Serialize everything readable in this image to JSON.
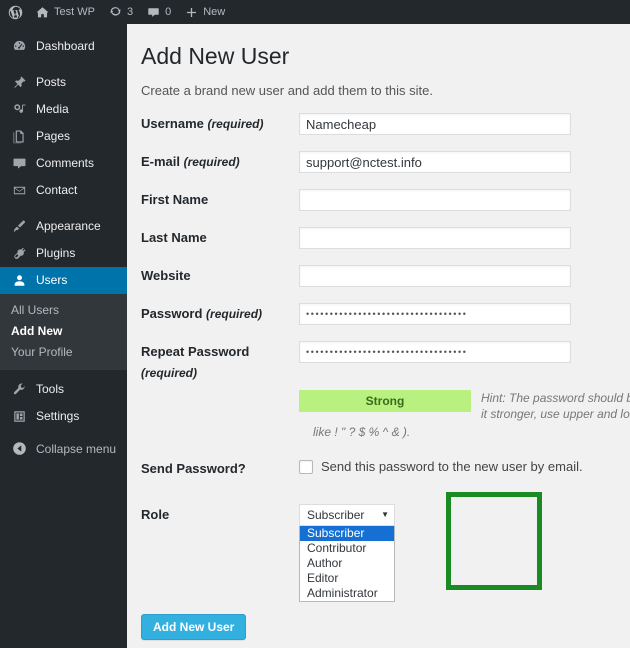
{
  "adminbar": {
    "items": [
      {
        "icon": "wordpress-logo-icon",
        "label": ""
      },
      {
        "icon": "home-icon",
        "label": "Test WP"
      },
      {
        "icon": "updates-icon",
        "label": "3"
      },
      {
        "icon": "comments-icon",
        "label": "0"
      },
      {
        "icon": "plus-icon",
        "label": "New"
      }
    ]
  },
  "sidebar": {
    "items": [
      {
        "label": "Dashboard",
        "icon": "dashboard-icon",
        "current": false
      },
      {
        "label": "Posts",
        "icon": "pin-icon",
        "current": false
      },
      {
        "label": "Media",
        "icon": "media-icon",
        "current": false
      },
      {
        "label": "Pages",
        "icon": "pages-icon",
        "current": false
      },
      {
        "label": "Comments",
        "icon": "comment-bubble-icon",
        "current": false
      },
      {
        "label": "Contact",
        "icon": "envelope-icon",
        "current": false
      },
      {
        "label": "Appearance",
        "icon": "paintbrush-icon",
        "current": false
      },
      {
        "label": "Plugins",
        "icon": "plug-icon",
        "current": false
      },
      {
        "label": "Users",
        "icon": "user-icon",
        "current": true
      },
      {
        "label": "Tools",
        "icon": "wrench-icon",
        "current": false
      },
      {
        "label": "Settings",
        "icon": "settings-icon",
        "current": false
      }
    ],
    "submenu": [
      {
        "label": "All Users",
        "current": false
      },
      {
        "label": "Add New",
        "current": true
      },
      {
        "label": "Your Profile",
        "current": false
      }
    ],
    "collapse": {
      "label": "Collapse menu",
      "icon": "collapse-arrow-icon"
    }
  },
  "page": {
    "title": "Add New User",
    "description": "Create a brand new user and add them to this site."
  },
  "form": {
    "username": {
      "label": "Username",
      "required_text": "(required)",
      "value": "Namecheap"
    },
    "email": {
      "label": "E-mail",
      "required_text": "(required)",
      "value": "support@nctest.info"
    },
    "first_name": {
      "label": "First Name",
      "value": ""
    },
    "last_name": {
      "label": "Last Name",
      "value": ""
    },
    "website": {
      "label": "Website",
      "value": ""
    },
    "password": {
      "label": "Password",
      "required_text": "(required)",
      "masked": "••••••••••••••••••••••••••••••••••"
    },
    "repeat_password": {
      "label": "Repeat Password",
      "required_text": "(required)",
      "masked": "••••••••••••••••••••••••••••••••••"
    },
    "strength": {
      "label": "Strong",
      "color": "#b8f17f"
    },
    "hint_line1": "Hint: The password should be a",
    "hint_line2": "it stronger, use upper and lowe",
    "hint_line3": "like ! \" ? $ % ^ & ).",
    "send_password": {
      "label": "Send Password?",
      "checkbox_label": "Send this password to the new user by email.",
      "checked": false
    },
    "role": {
      "label": "Role",
      "selected": "Subscriber",
      "options": [
        "Subscriber",
        "Contributor",
        "Author",
        "Editor",
        "Administrator"
      ],
      "highlight_color": "#1a8a23"
    },
    "submit_label": "Add New User"
  }
}
